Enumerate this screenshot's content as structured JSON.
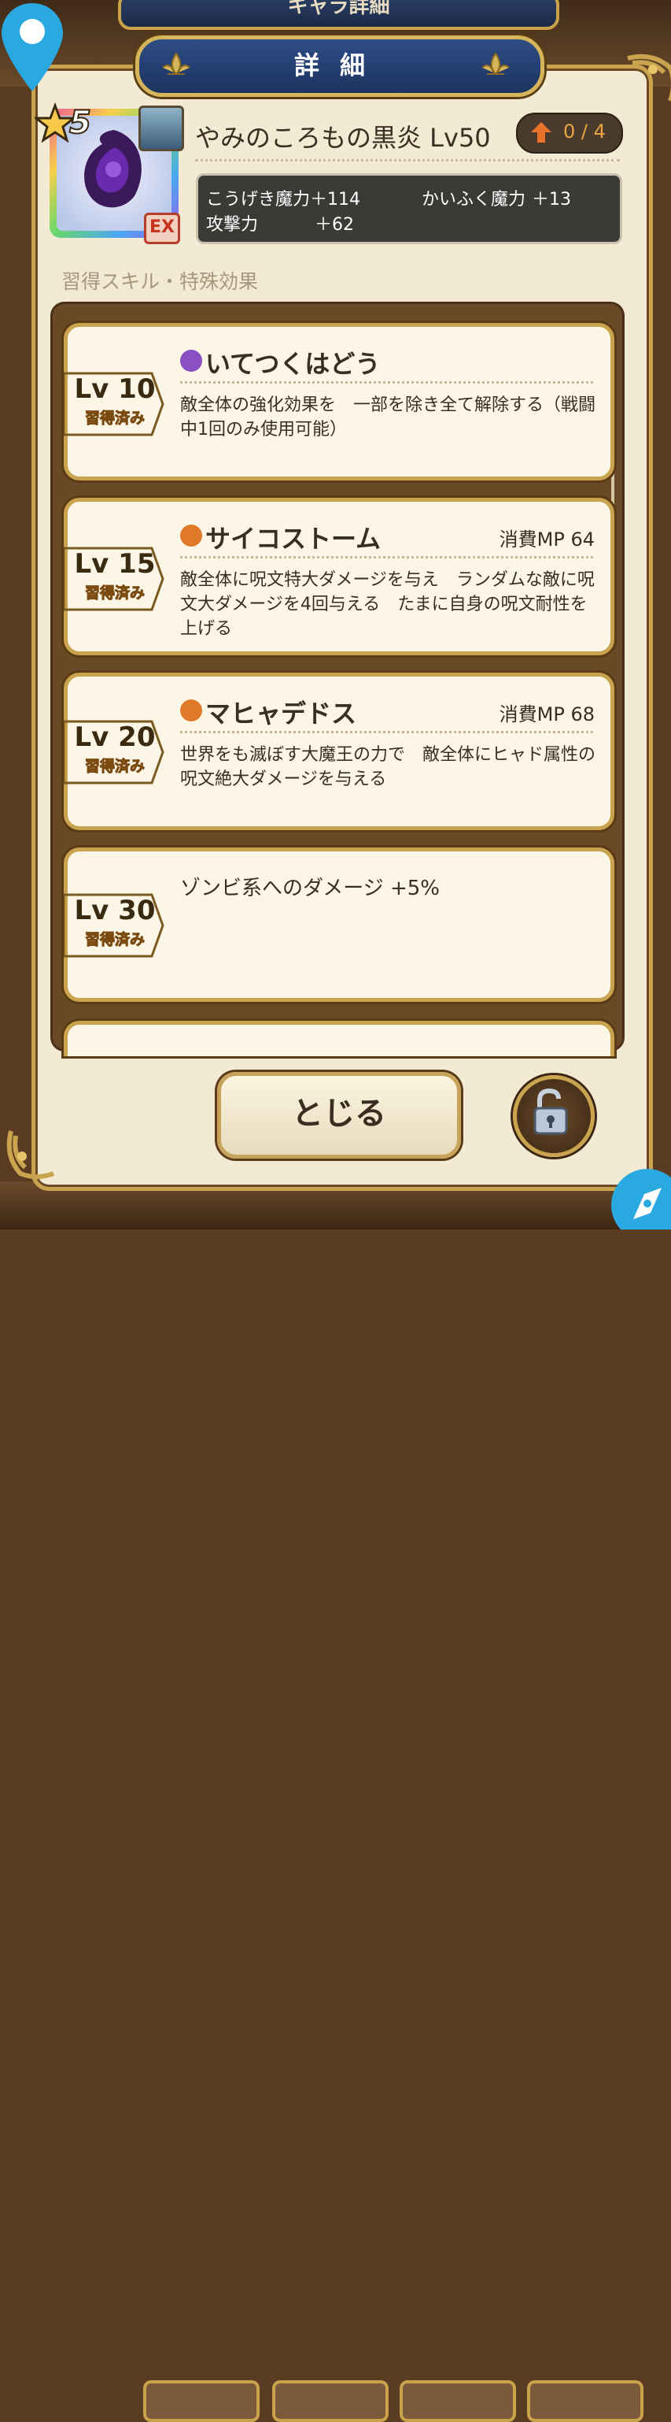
{
  "header": {
    "background_title": "キャラ詳細",
    "title": "詳細"
  },
  "item": {
    "rarity": "5",
    "name": "やみのころもの黒炎 Lv50",
    "ex_badge": "EX",
    "upgrade_count": "0 / 4",
    "stats": [
      {
        "label": "こうげき魔力",
        "value": "＋114"
      },
      {
        "label": "かいふく魔力",
        "value": "＋13"
      },
      {
        "label": "攻撃力",
        "value": "＋62"
      }
    ]
  },
  "section_label": "習得スキル・特殊効果",
  "skills": [
    {
      "level": "Lv 10",
      "status": "習得済み",
      "name": "いてつくはどう",
      "orb_color": "#8a4fc2",
      "mp": "",
      "description": "敵全体の強化効果を　一部を除き全て解除する（戦闘中1回のみ使用可能）"
    },
    {
      "level": "Lv 15",
      "status": "習得済み",
      "name": "サイコストーム",
      "orb_color": "#e07a2a",
      "mp": "消費MP 64",
      "description": "敵全体に呪文特大ダメージを与え　ランダムな敵に呪文大ダメージを4回与える　たまに自身の呪文耐性を上げる"
    },
    {
      "level": "Lv 20",
      "status": "習得済み",
      "name": "マヒャデドス",
      "orb_color": "#e07a2a",
      "mp": "消費MP 68",
      "description": "世界をも滅ぼす大魔王の力で　敵全体にヒャド属性の　呪文絶大ダメージを与える"
    },
    {
      "level": "Lv 30",
      "status": "習得済み",
      "name": "ゾンビ系へのダメージ +5%",
      "orb_color": "",
      "mp": "",
      "description": ""
    }
  ],
  "buttons": {
    "close_label": "とじる"
  },
  "icons": {
    "location_marker": "map-pin-icon",
    "compass": "compass-icon",
    "upgrade": "up-arrow-icon",
    "lock": "unlocked-padlock-icon",
    "star": "rainbow-star-icon"
  },
  "colors": {
    "title_plate": "#1b335f",
    "gold_border": "#c9a34e",
    "panel_bg": "#f3ead4",
    "upgrade_text": "#e9a640",
    "lv_tag": "#f1c232"
  }
}
